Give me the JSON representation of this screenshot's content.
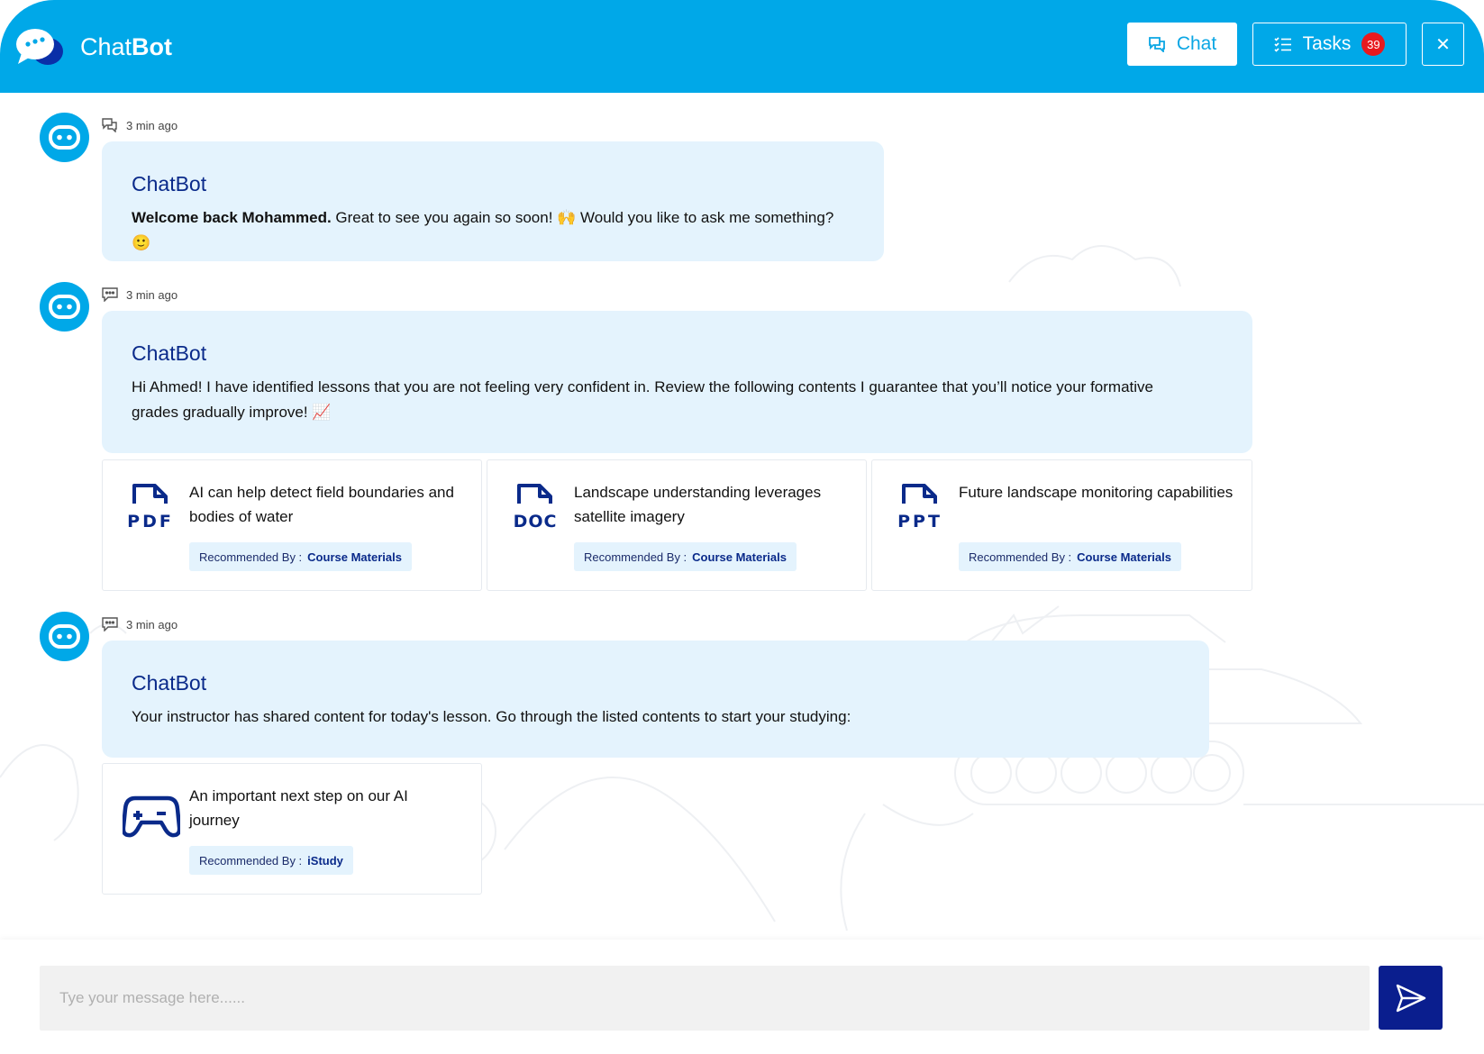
{
  "header": {
    "brand_light": "Chat",
    "brand_bold": "Bot",
    "chat_label": "Chat",
    "tasks_label": "Tasks",
    "tasks_count": "39",
    "close_symbol": "✕",
    "color": "#00a8e8"
  },
  "messages": [
    {
      "time": "3 min ago",
      "sender": "ChatBot",
      "text_bold": "Welcome back Mohammed.",
      "text": " Great to see you again so soon! 🙌 Would you like to ask me something? 🙂"
    },
    {
      "time": "3 min ago",
      "sender": "ChatBot",
      "text": "Hi Ahmed! I have identified lessons that you are not feeling very confident in. Review the following contents I guarantee that you’ll notice your formative grades gradually improve! 📈",
      "cards": [
        {
          "type_label": "PDF",
          "title": "AI can help detect field boundaries and bodies of water",
          "rec_label": "Recommended By :",
          "rec_value": "Course Materials"
        },
        {
          "type_label": "DOC",
          "title": "Landscape understanding leverages satellite imagery",
          "rec_label": "Recommended By :",
          "rec_value": "Course Materials"
        },
        {
          "type_label": "PPT",
          "title": "Future landscape monitoring capabilities",
          "rec_label": "Recommended By :",
          "rec_value": "Course Materials"
        }
      ]
    },
    {
      "time": "3 min ago",
      "sender": "ChatBot",
      "text": "Your instructor has shared content for today's lesson. Go through the listed contents to start your studying:",
      "cards": [
        {
          "title": "An important next step on our AI journey",
          "rec_label": "Recommended By :",
          "rec_value": "iStudy"
        }
      ]
    }
  ],
  "composer": {
    "placeholder": "Tye your message here......"
  },
  "colors": {
    "accent": "#00a8e8",
    "dark_blue": "#0a1e8e",
    "bubble": "#e4f3fd",
    "badge": "#e8191e"
  },
  "icons": {
    "logo": "chat-bubbles-icon",
    "chat": "chat-icon",
    "tasks": "checklist-icon",
    "close": "close-icon",
    "avatar": "robot-face-icon",
    "send": "send-icon",
    "game": "gamepad-icon"
  }
}
